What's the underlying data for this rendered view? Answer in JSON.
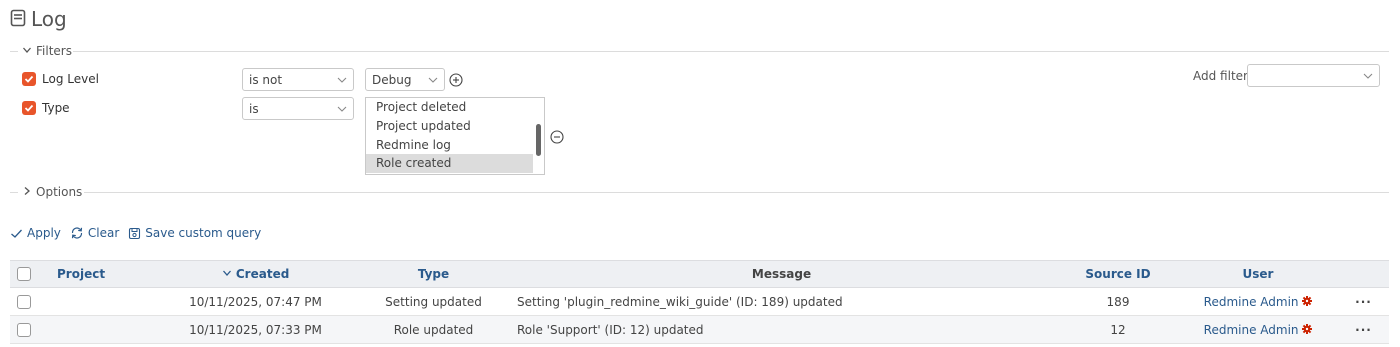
{
  "page": {
    "title": "Log"
  },
  "filters": {
    "legend": "Filters",
    "rows": [
      {
        "label": "Log Level",
        "operator": "is not",
        "value": "Debug"
      },
      {
        "label": "Type",
        "operator": "is",
        "values": [
          "Project deleted",
          "Project updated",
          "Redmine log",
          "Role created"
        ],
        "selected": "Role created"
      }
    ],
    "add_filter_label": "Add filter",
    "add_filter_value": ""
  },
  "options": {
    "legend": "Options"
  },
  "actions": {
    "apply": "Apply",
    "clear": "Clear",
    "save": "Save custom query"
  },
  "table": {
    "headers": {
      "project": "Project",
      "created": "Created",
      "type": "Type",
      "message": "Message",
      "source_id": "Source ID",
      "user": "User"
    },
    "sorted_column": "created",
    "rows": [
      {
        "project": "",
        "created": "10/11/2025, 07:47 PM",
        "type": "Setting updated",
        "message": "Setting 'plugin_redmine_wiki_guide' (ID: 189) updated",
        "source_id": "189",
        "user": "Redmine Admin",
        "menu": "···"
      },
      {
        "project": "",
        "created": "10/11/2025, 07:33 PM",
        "type": "Role updated",
        "message": "Role 'Support' (ID: 12) updated",
        "source_id": "12",
        "user": "Redmine Admin",
        "menu": "···"
      }
    ]
  },
  "colors": {
    "accent": "#2a5a8c",
    "checkbox": "#e8552b",
    "admin_badge": "#cc2200",
    "header_bg": "#eef0f3"
  },
  "icons": {
    "title": "log-icon",
    "expand": "chevron-down-icon",
    "collapse": "chevron-right-icon",
    "add": "plus-circle-icon",
    "remove": "minus-circle-icon"
  }
}
